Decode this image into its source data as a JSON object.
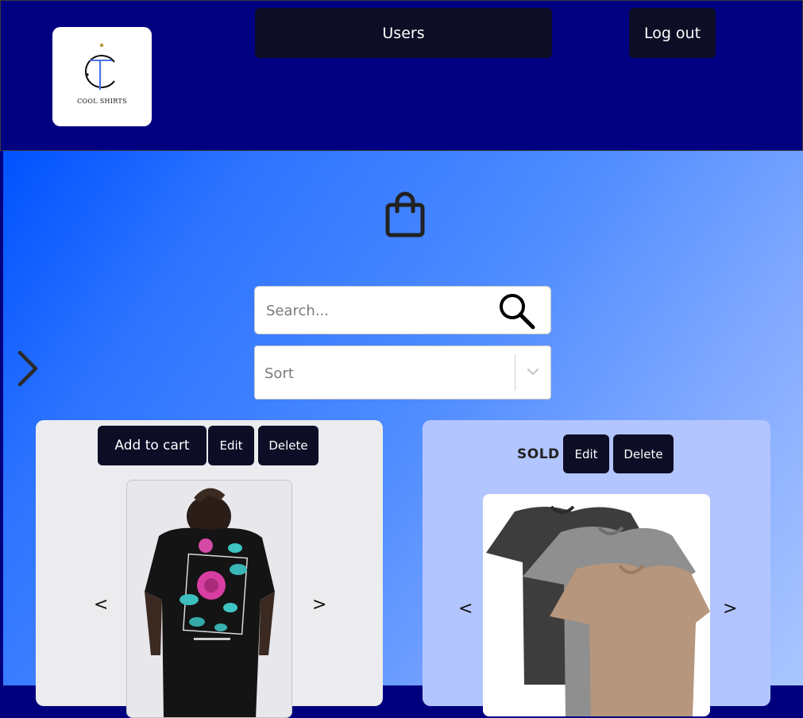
{
  "header": {
    "logo_text": "COOL SHIRTS",
    "users_label": "Users",
    "logout_label": "Log out"
  },
  "main": {
    "icons": {
      "bag": "shopping-bag-icon",
      "side_arrow": "chevron-right-icon",
      "search": "search-icon"
    },
    "search": {
      "placeholder": "Search..."
    },
    "sort": {
      "placeholder": "Sort"
    }
  },
  "cards": [
    {
      "add_to_cart_label": "Add to cart",
      "edit_label": "Edit",
      "delete_label": "Delete",
      "prev_label": "<",
      "next_label": ">"
    },
    {
      "status_label": "SOLD",
      "edit_label": "Edit",
      "delete_label": "Delete",
      "prev_label": "<",
      "next_label": ">"
    }
  ],
  "colors": {
    "header_bg": "#000080",
    "button_bg": "#0d0d26",
    "card1_bg": "#ececee",
    "card2_bg": "#b3c5ff"
  }
}
